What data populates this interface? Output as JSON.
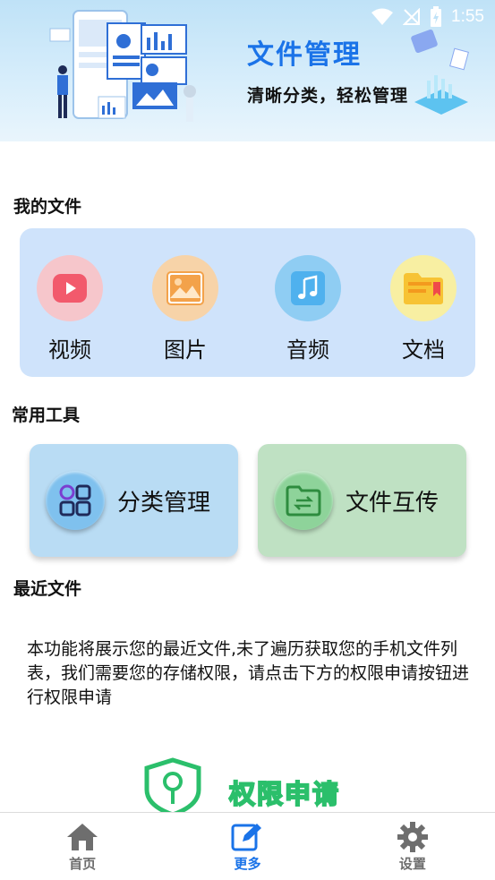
{
  "status": {
    "time": "1:55"
  },
  "banner": {
    "title": "文件管理",
    "subtitle": "清晰分类，轻松管理"
  },
  "my_files": {
    "title": "我的文件",
    "items": [
      {
        "label": "视频",
        "icon": "video-play-icon",
        "bg": "#f6c6cb",
        "color": "#f25a6c"
      },
      {
        "label": "图片",
        "icon": "image-icon",
        "bg": "#f7d3a8",
        "color": "#f3a24a"
      },
      {
        "label": "音频",
        "icon": "music-note-icon",
        "bg": "#8fcdf3",
        "color": "#4fb1ee"
      },
      {
        "label": "文档",
        "icon": "folder-document-icon",
        "bg": "#f8efa2",
        "color": "#f7c334"
      }
    ]
  },
  "tools": {
    "title": "常用工具",
    "items": [
      {
        "label": "分类管理",
        "icon": "category-grid-icon",
        "card_color": "#b9dcf4"
      },
      {
        "label": "文件互传",
        "icon": "folder-transfer-icon",
        "card_color": "#bfe1c3"
      }
    ]
  },
  "recent": {
    "title": "最近文件",
    "message": "本功能将展示您的最近文件,未了遍历获取您的手机文件列表，我们需要您的存储权限，请点击下方的权限申请按钮进行权限申请",
    "permission_button": "权限申请"
  },
  "nav": {
    "items": [
      {
        "label": "首页",
        "icon": "home-icon"
      },
      {
        "label": "更多",
        "icon": "edit-icon",
        "active": true
      },
      {
        "label": "设置",
        "icon": "gear-icon"
      }
    ]
  },
  "colors": {
    "accent": "#1a73e8",
    "permission_green": "#2bbf6b"
  }
}
